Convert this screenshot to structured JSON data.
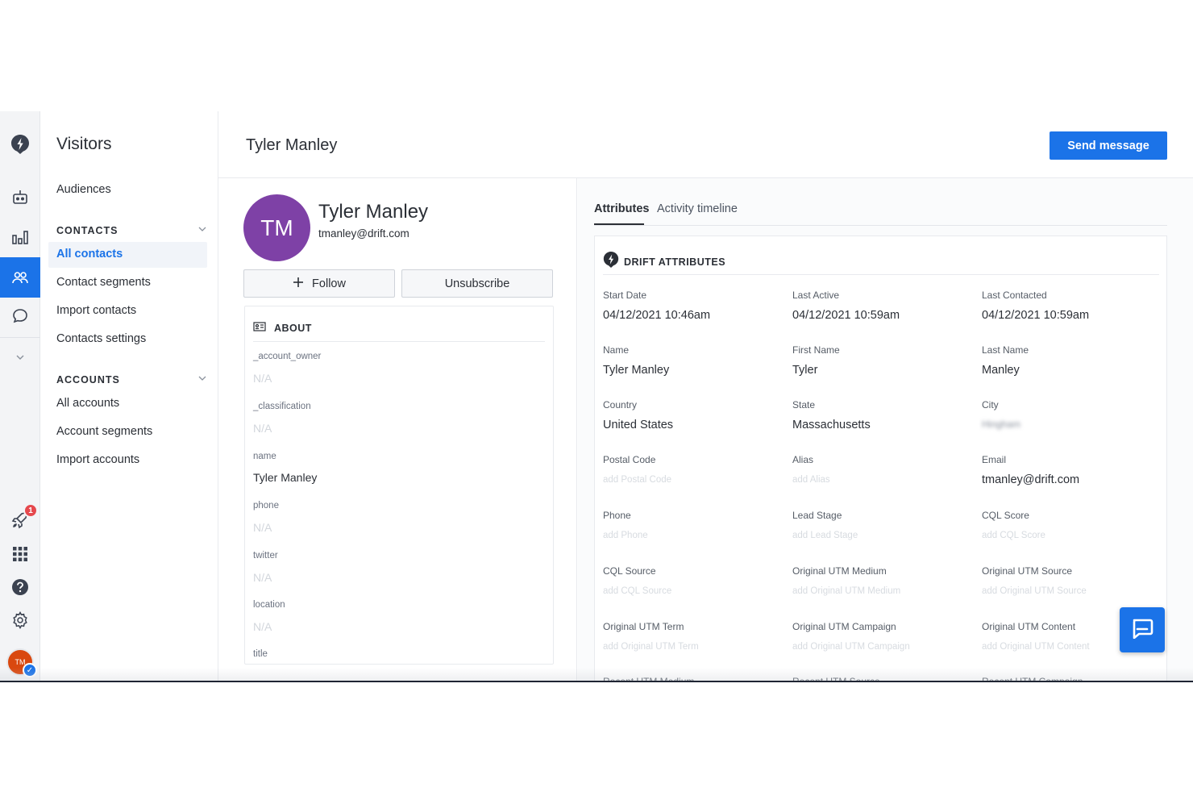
{
  "icons": {
    "rail": [
      "drift-logo-icon",
      "bot-icon",
      "reports-icon",
      "contacts-icon",
      "conversations-icon",
      "expand-chevron-icon",
      "rocket-icon",
      "apps-grid-icon",
      "help-icon",
      "settings-icon"
    ],
    "chat": "chat-bubble-icon",
    "about": "id-card-icon",
    "drift": "drift-logo-icon",
    "follow": "plus-icon"
  },
  "colors": {
    "accent": "#1b73e8",
    "avatar": "#7e41a6",
    "badge": "#e5484d",
    "user_avatar": "#d9480f"
  },
  "rail": {
    "notification_count": "1",
    "user_initials": "TM"
  },
  "subnav": {
    "title": "Visitors",
    "audiences": "Audiences",
    "contacts_heading": "CONTACTS",
    "contacts_items": [
      "All contacts",
      "Contact segments",
      "Import contacts",
      "Contacts settings"
    ],
    "accounts_heading": "ACCOUNTS",
    "accounts_items": [
      "All accounts",
      "Account segments",
      "Import accounts"
    ]
  },
  "header": {
    "title": "Tyler Manley",
    "send_button": "Send message"
  },
  "profile": {
    "initials": "TM",
    "name": "Tyler Manley",
    "email": "tmanley@drift.com",
    "follow_label": "Follow",
    "unsubscribe_label": "Unsubscribe",
    "about_title": "ABOUT",
    "about_fields": [
      {
        "label": "_account_owner",
        "value": "N/A"
      },
      {
        "label": "_classification",
        "value": "N/A"
      },
      {
        "label": "name",
        "value": "Tyler Manley"
      },
      {
        "label": "phone",
        "value": "N/A"
      },
      {
        "label": "twitter",
        "value": "N/A"
      },
      {
        "label": "location",
        "value": "N/A"
      },
      {
        "label": "title",
        "value": ""
      }
    ]
  },
  "attributes": {
    "tabs": [
      "Attributes",
      "Activity timeline"
    ],
    "section_title": "DRIFT ATTRIBUTES",
    "fields": [
      {
        "label": "Start Date",
        "value": "04/12/2021 10:46am"
      },
      {
        "label": "Last Active",
        "value": "04/12/2021 10:59am"
      },
      {
        "label": "Last Contacted",
        "value": "04/12/2021 10:59am"
      },
      {
        "label": "Name",
        "value": "Tyler Manley"
      },
      {
        "label": "First Name",
        "value": "Tyler"
      },
      {
        "label": "Last Name",
        "value": "Manley"
      },
      {
        "label": "Country",
        "value": "United States"
      },
      {
        "label": "State",
        "value": "Massachusetts"
      },
      {
        "label": "City",
        "value": "Hingham"
      },
      {
        "label": "Postal Code",
        "value": "add Postal Code"
      },
      {
        "label": "Alias",
        "value": "add Alias"
      },
      {
        "label": "Email",
        "value": "tmanley@drift.com"
      },
      {
        "label": "Phone",
        "value": "add Phone"
      },
      {
        "label": "Lead Stage",
        "value": "add Lead Stage"
      },
      {
        "label": "CQL Score",
        "value": "add CQL Score"
      },
      {
        "label": "CQL Source",
        "value": "add CQL Source"
      },
      {
        "label": "Original UTM Medium",
        "value": "add Original UTM Medium"
      },
      {
        "label": "Original UTM Source",
        "value": "add Original UTM Source"
      },
      {
        "label": "Original UTM Term",
        "value": "add Original UTM Term"
      },
      {
        "label": "Original UTM Campaign",
        "value": "add Original UTM Campaign"
      },
      {
        "label": "Original UTM Content",
        "value": "add Original UTM Content"
      },
      {
        "label": "Recent UTM Medium",
        "value": ""
      },
      {
        "label": "Recent UTM Source",
        "value": ""
      },
      {
        "label": "Recent UTM Campaign",
        "value": ""
      }
    ]
  }
}
